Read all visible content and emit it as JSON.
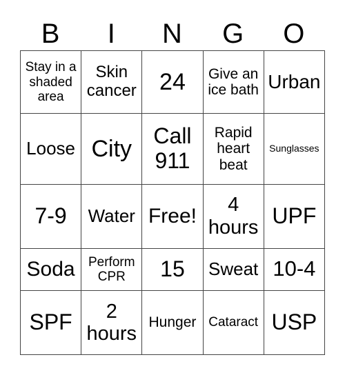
{
  "header": [
    "B",
    "I",
    "N",
    "G",
    "O"
  ],
  "cells": [
    [
      {
        "t": "Stay in a shaded area",
        "s": 19
      },
      {
        "t": "Skin cancer",
        "s": 24
      },
      {
        "t": "24",
        "s": 34
      },
      {
        "t": "Give an ice bath",
        "s": 21
      },
      {
        "t": "Urban",
        "s": 28
      }
    ],
    [
      {
        "t": "Loose",
        "s": 26
      },
      {
        "t": "City",
        "s": 34
      },
      {
        "t": "Call 911",
        "s": 32
      },
      {
        "t": "Rapid heart beat",
        "s": 21
      },
      {
        "t": "Sunglasses",
        "s": 14
      }
    ],
    [
      {
        "t": "7-9",
        "s": 32
      },
      {
        "t": "Water",
        "s": 26
      },
      {
        "t": "Free!",
        "s": 30
      },
      {
        "t": "4 hours",
        "s": 29
      },
      {
        "t": "UPF",
        "s": 32
      }
    ],
    [
      {
        "t": "Soda",
        "s": 30
      },
      {
        "t": "Perform CPR",
        "s": 19
      },
      {
        "t": "15",
        "s": 32
      },
      {
        "t": "Sweat",
        "s": 26
      },
      {
        "t": "10-4",
        "s": 31
      }
    ],
    [
      {
        "t": "SPF",
        "s": 32
      },
      {
        "t": "2 hours",
        "s": 29
      },
      {
        "t": "Hunger",
        "s": 21
      },
      {
        "t": "Cataract",
        "s": 19
      },
      {
        "t": "USP",
        "s": 32
      }
    ]
  ]
}
